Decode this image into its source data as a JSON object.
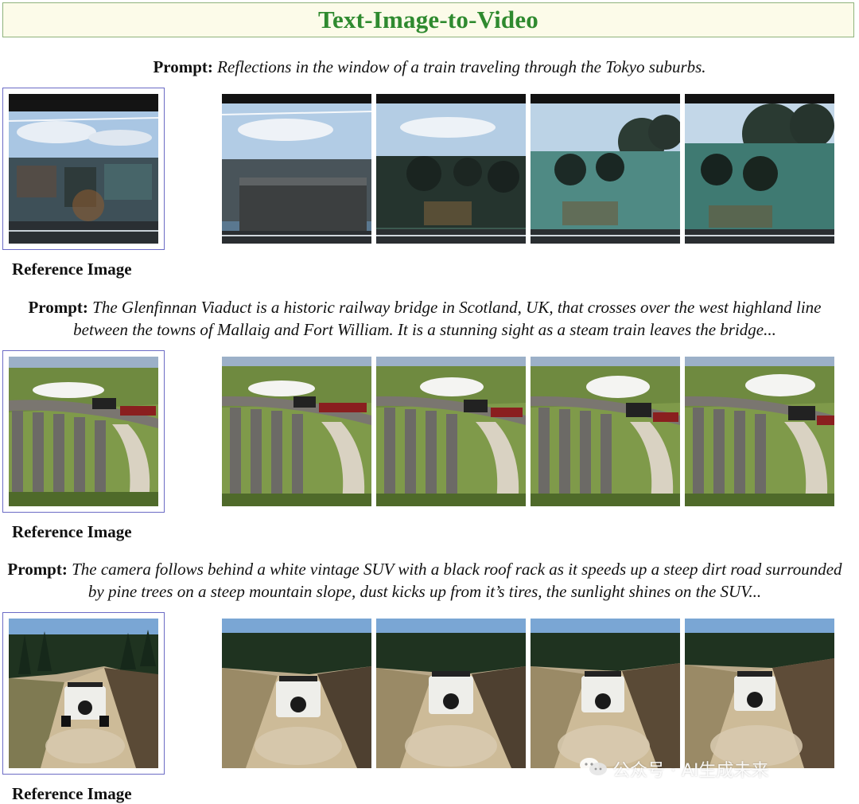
{
  "title": "Text-Image-to-Video",
  "rows": [
    {
      "prompt_label": "Prompt:",
      "prompt_text": "Reflections in the window of a train traveling through the Tokyo suburbs.",
      "reference_label": "Reference Image"
    },
    {
      "prompt_label": "Prompt:",
      "prompt_text": "The Glenfinnan Viaduct is a historic railway bridge in Scotland, UK, that crosses over the west highland line between the towns of Mallaig and Fort William. It is a stunning sight as a steam train leaves the bridge...",
      "reference_label": "Reference Image"
    },
    {
      "prompt_label": "Prompt:",
      "prompt_text": "The camera follows behind a white vintage SUV with a black roof rack as it speeds up a steep dirt road surrounded by pine trees on a steep mountain slope, dust kicks up from it’s tires, the sunlight shines on the SUV...",
      "reference_label": "Reference Image"
    }
  ],
  "watermark": "公众号 · AI生成未来",
  "colors": {
    "title_text": "#2f8a2f",
    "title_background": "#fcfbe9",
    "title_border": "#8fb37c",
    "reference_border": "#6b6bc5"
  }
}
